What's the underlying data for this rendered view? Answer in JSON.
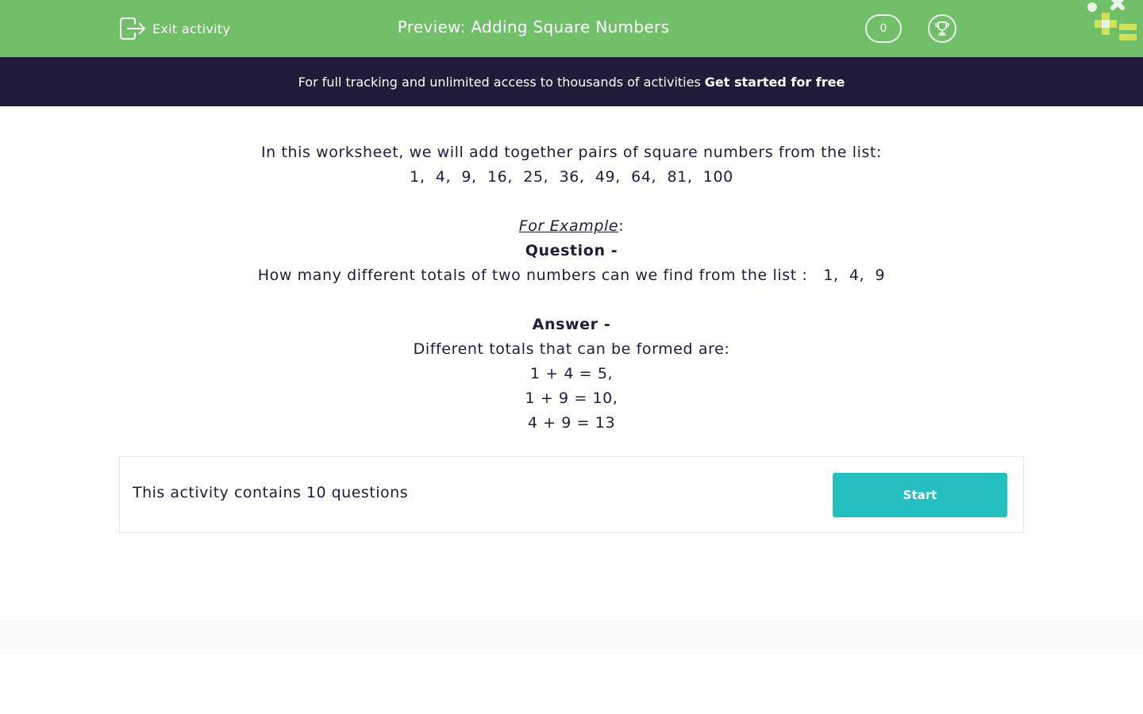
{
  "header": {
    "exit_label": "Exit activity",
    "title": "Preview: Adding Square Numbers",
    "score": "0"
  },
  "banner": {
    "text": "For full tracking and unlimited access to thousands of activities",
    "cta": "Get started for free"
  },
  "intro": {
    "line1": "In this worksheet, we will add together pairs of square numbers from the list:",
    "line2": "1,  4,  9,  16,  25,  36,  49,  64,  81,  100"
  },
  "example": {
    "label": "For Example",
    "colon": ":",
    "question_heading": "Question -",
    "question_text": "How many different totals of two numbers can we find from the list :   1,  4,  9",
    "answer_heading": "Answer -",
    "answer_intro": "Different totals that can be formed are:",
    "answers": [
      "1 + 4 = 5,",
      "1 + 9 = 10,",
      "4 + 9 = 13"
    ]
  },
  "activity": {
    "summary": "This activity contains 10 questions",
    "start_label": "Start"
  },
  "colors": {
    "header_green": "#72bf6a",
    "banner_navy": "#211b3a",
    "start_teal": "#24bfbf",
    "text_dark": "#201b3a"
  },
  "icons": {
    "exit": "exit-door-arrow-icon",
    "trophy": "trophy-icon",
    "logo": "math-symbols-logo"
  }
}
